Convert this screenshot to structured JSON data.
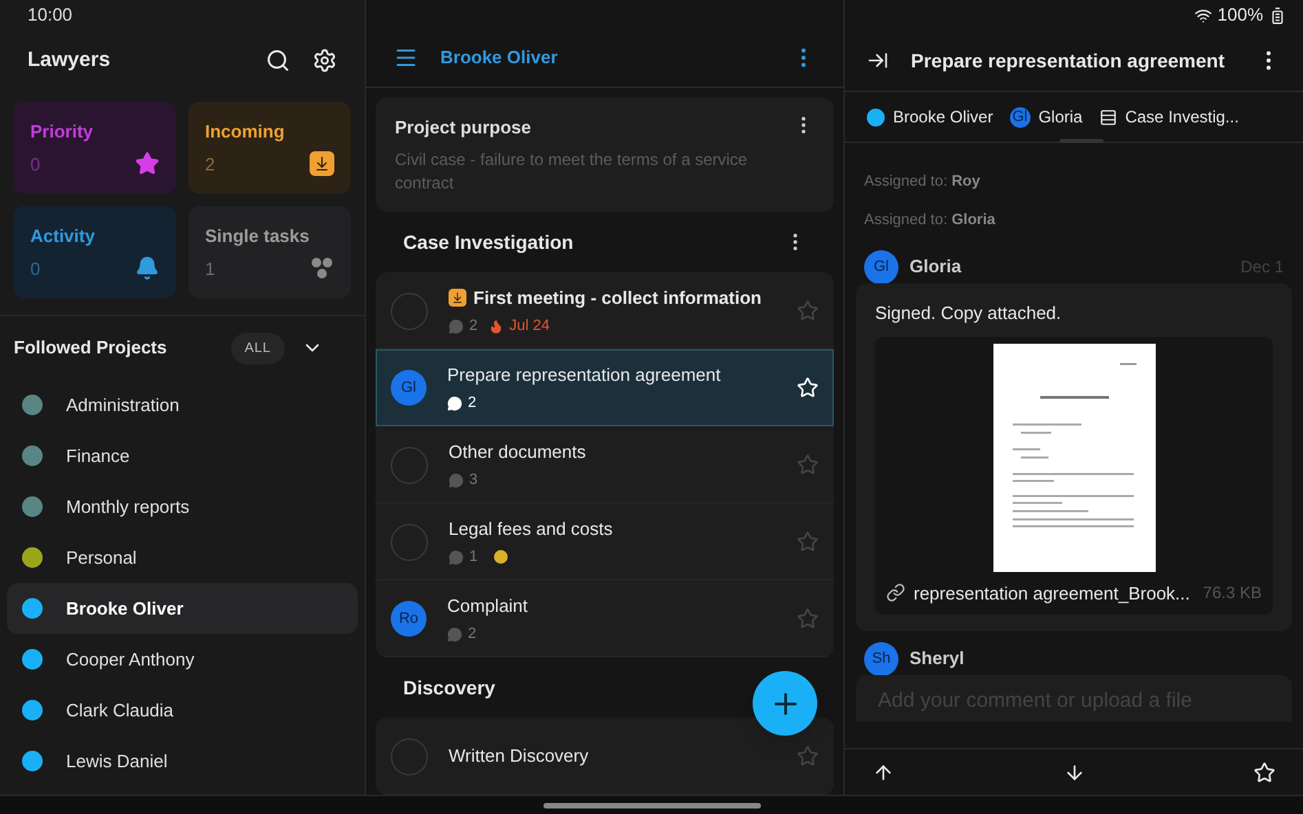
{
  "status_bar": {
    "time": "10:00",
    "battery": "100%"
  },
  "sidebar": {
    "title": "Lawyers",
    "tiles": [
      {
        "kind": "priority",
        "label": "Priority",
        "count": "0"
      },
      {
        "kind": "incoming",
        "label": "Incoming",
        "count": "2"
      },
      {
        "kind": "activity",
        "label": "Activity",
        "count": "0"
      },
      {
        "kind": "single",
        "label": "Single tasks",
        "count": "1"
      }
    ],
    "followed": {
      "title": "Followed Projects",
      "filter": "ALL",
      "expanded": false
    },
    "projects": [
      {
        "name": "Administration",
        "color": "#5a8585",
        "selected": false
      },
      {
        "name": "Finance",
        "color": "#5a8585",
        "selected": false
      },
      {
        "name": "Monthly reports",
        "color": "#5a8585",
        "selected": false
      },
      {
        "name": "Personal",
        "color": "#9aa61a",
        "selected": false
      },
      {
        "name": "Brooke Oliver",
        "color": "#1ab0f5",
        "selected": true
      },
      {
        "name": "Cooper Anthony",
        "color": "#1ab0f5",
        "selected": false
      },
      {
        "name": "Clark Claudia",
        "color": "#1ab0f5",
        "selected": false
      },
      {
        "name": "Lewis Daniel",
        "color": "#1ab0f5",
        "selected": false
      }
    ]
  },
  "project": {
    "title": "Brooke Oliver",
    "purpose": {
      "title": "Project purpose",
      "text": "Civil case - failure to meet the terms of a service contract"
    },
    "sections": [
      {
        "title": "Case Investigation",
        "tasks": [
          {
            "title": "First meeting - collect information",
            "comments": "2",
            "due": "Jul 24",
            "incoming": true,
            "billing": false,
            "selected": false
          },
          {
            "title": "Prepare representation agreement",
            "assignee": "Gl",
            "comments": "2",
            "incoming": false,
            "billing": false,
            "selected": true
          },
          {
            "title": "Other documents",
            "comments": "3",
            "incoming": false,
            "billing": false,
            "selected": false
          },
          {
            "title": "Legal fees and costs",
            "comments": "1",
            "incoming": false,
            "billing": true,
            "selected": false
          },
          {
            "title": "Complaint",
            "assignee": "Ro",
            "comments": "2",
            "incoming": false,
            "billing": false,
            "selected": false
          }
        ]
      },
      {
        "title": "Discovery",
        "tasks": [
          {
            "title": "Written Discovery",
            "incoming": false,
            "billing": false,
            "selected": false
          }
        ]
      }
    ]
  },
  "detail": {
    "title": "Prepare representation agreement",
    "breadcrumbs": [
      {
        "kind": "project",
        "label": "Brooke Oliver",
        "color": "#1ab0f5"
      },
      {
        "kind": "assignee",
        "label": "Gloria",
        "initials": "Gl"
      },
      {
        "kind": "section",
        "label": "Case Investig..."
      }
    ],
    "activity": [
      "Assigned to: **Roy**",
      "Assigned to: **Gloria**"
    ],
    "comments": [
      {
        "author": "Gloria",
        "initials": "Gl",
        "date": "Dec 1",
        "text": "Signed. Copy attached.",
        "attachment": {
          "name": "representation agreement_Brook...",
          "size": "76.3 KB"
        }
      },
      {
        "author": "Sheryl",
        "initials": "Sh"
      }
    ],
    "comment_field": {
      "placeholder": "Add your comment or upload a file"
    }
  }
}
